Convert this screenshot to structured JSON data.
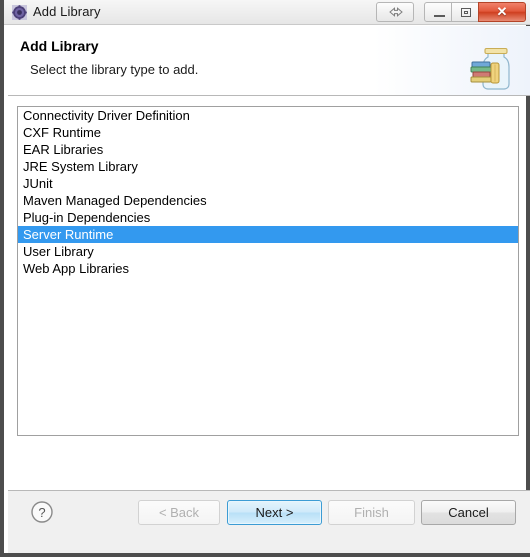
{
  "window": {
    "title": "Add Library",
    "icon": "eclipse-wizard-icon",
    "controls": {
      "help": "resize-arrows-icon",
      "minimize": "minimize-icon",
      "maximize": "maximize-icon",
      "close": "✕"
    }
  },
  "header": {
    "title": "Add Library",
    "subtitle": "Select the library type to add.",
    "icon": "library-jar-books-icon"
  },
  "list": {
    "items": [
      {
        "label": "Connectivity Driver Definition",
        "selected": false
      },
      {
        "label": "CXF Runtime",
        "selected": false
      },
      {
        "label": "EAR Libraries",
        "selected": false
      },
      {
        "label": "JRE System Library",
        "selected": false
      },
      {
        "label": "JUnit",
        "selected": false
      },
      {
        "label": "Maven Managed Dependencies",
        "selected": false
      },
      {
        "label": "Plug-in Dependencies",
        "selected": false
      },
      {
        "label": "Server Runtime",
        "selected": true
      },
      {
        "label": "User Library",
        "selected": false
      },
      {
        "label": "Web App Libraries",
        "selected": false
      }
    ],
    "selected_value": "Server Runtime"
  },
  "buttons": {
    "help": "?",
    "back": "< Back",
    "next": "Next >",
    "finish": "Finish",
    "cancel": "Cancel"
  },
  "colors": {
    "selection_blue": "#3399ef",
    "default_button_border": "#3c9cd4",
    "close_button_red": "#cf3f20",
    "disabled_text": "#b0b0b0"
  }
}
